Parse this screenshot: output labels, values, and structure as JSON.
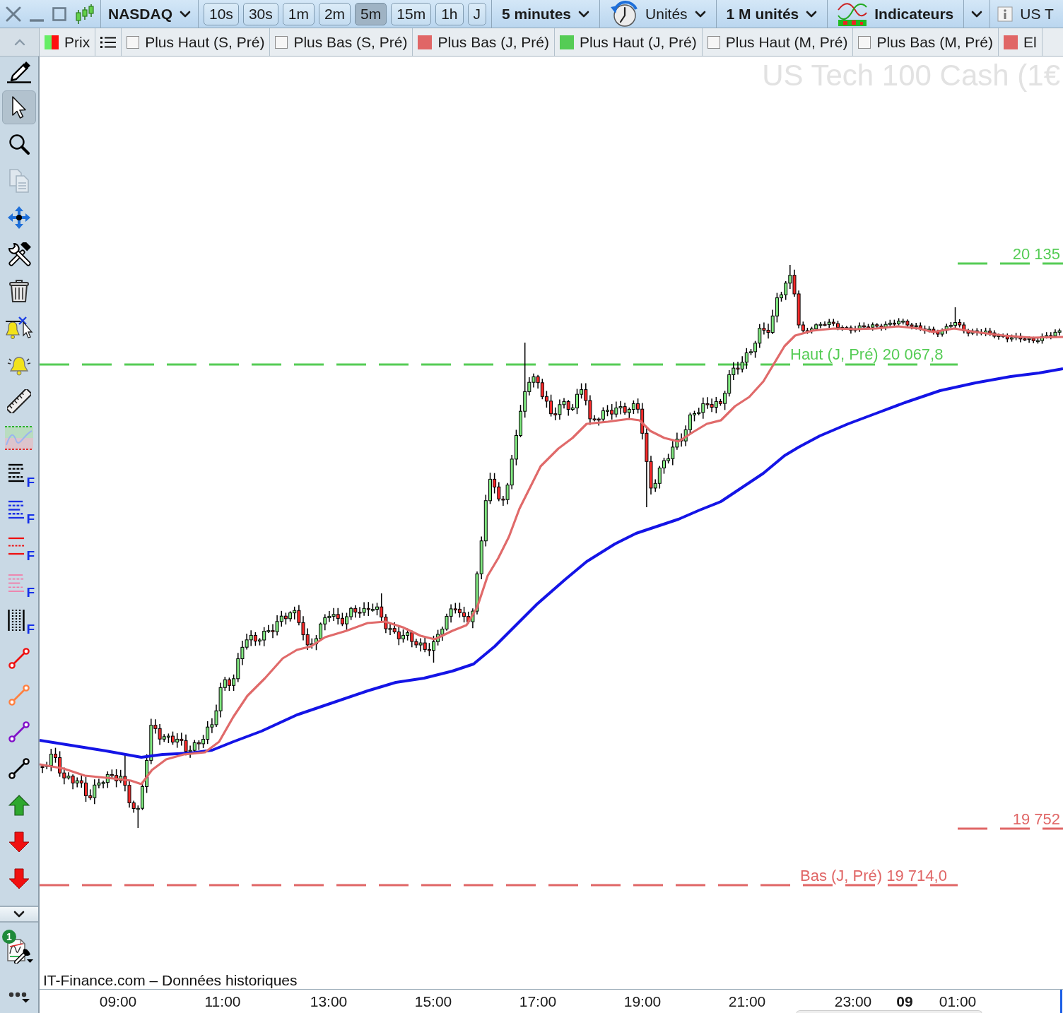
{
  "toolbar": {
    "market": "NASDAQ",
    "timeframes": [
      {
        "label": "10s",
        "selected": false
      },
      {
        "label": "30s",
        "selected": false
      },
      {
        "label": "1m",
        "selected": false
      },
      {
        "label": "2m",
        "selected": false
      },
      {
        "label": "5m",
        "selected": true
      },
      {
        "label": "15m",
        "selected": false
      },
      {
        "label": "1h",
        "selected": false
      },
      {
        "label": "J",
        "selected": false
      }
    ],
    "period": "5 minutes",
    "units": "Unités",
    "unit_count": "1 M unités",
    "indicators": "Indicateurs",
    "instrument": "US T"
  },
  "legend": {
    "items": [
      {
        "kind": "price",
        "label": "Prix"
      },
      {
        "kind": "list"
      },
      {
        "kind": "checkbox",
        "label": "Plus Haut (S, Pré)",
        "checked": false
      },
      {
        "kind": "checkbox",
        "label": "Plus Bas (S, Pré)",
        "checked": false
      },
      {
        "kind": "swatch",
        "label": "Plus Bas (J, Pré)",
        "color": "#e06666"
      },
      {
        "kind": "swatch",
        "label": "Plus Haut (J, Pré)",
        "color": "#55cc55"
      },
      {
        "kind": "checkbox",
        "label": "Plus Haut (M, Pré)",
        "checked": false
      },
      {
        "kind": "checkbox",
        "label": "Plus Bas (M, Pré)",
        "checked": false
      },
      {
        "kind": "swatch",
        "label": "El",
        "color": "#e06666"
      }
    ]
  },
  "tools": [
    {
      "kind": "pencil",
      "selected": false,
      "disabled": false
    },
    {
      "kind": "pointer",
      "selected": true,
      "disabled": false
    },
    {
      "kind": "zoom",
      "selected": false,
      "disabled": false
    },
    {
      "kind": "copy",
      "selected": false,
      "disabled": true
    },
    {
      "kind": "move",
      "selected": false,
      "disabled": false
    },
    {
      "kind": "tools",
      "selected": false,
      "disabled": false
    },
    {
      "kind": "trash",
      "selected": false,
      "disabled": false
    },
    {
      "kind": "alertcursor",
      "selected": false,
      "disabled": false
    },
    {
      "kind": "alert",
      "selected": false,
      "disabled": false
    },
    {
      "kind": "ruler",
      "selected": false,
      "disabled": false
    },
    {
      "kind": "band",
      "selected": false,
      "disabled": false
    },
    {
      "kind": "fibo",
      "label": "F",
      "selected": false,
      "disabled": false
    },
    {
      "kind": "fiboblue",
      "label": "F",
      "selected": false,
      "disabled": false
    },
    {
      "kind": "fibored",
      "label": "F",
      "selected": false,
      "disabled": false
    },
    {
      "kind": "fibopink",
      "label": "F",
      "selected": false,
      "disabled": false
    },
    {
      "kind": "fibotime",
      "label": "F",
      "selected": false,
      "disabled": false
    },
    {
      "kind": "segment",
      "color": "#ee1111",
      "selected": false,
      "disabled": false
    },
    {
      "kind": "segment",
      "color": "#ff8040",
      "selected": false,
      "disabled": false
    },
    {
      "kind": "segment",
      "color": "#8010c8",
      "selected": false,
      "disabled": false
    },
    {
      "kind": "segment",
      "color": "#000000",
      "selected": false,
      "disabled": false
    },
    {
      "kind": "uparrow",
      "selected": false,
      "disabled": false
    },
    {
      "kind": "downarrow",
      "selected": false,
      "disabled": false
    },
    {
      "kind": "downarrow",
      "selected": false,
      "disabled": false
    }
  ],
  "tool_panel": {
    "settings_badge": "1"
  },
  "chart": {
    "title": "US Tech 100 Cash (1€",
    "levels": [
      {
        "kind": "mark",
        "label": "20 135",
        "color": "#55cc55"
      },
      {
        "kind": "line",
        "label": "Haut (J, Pré) 20 067,8",
        "color": "#55cc55"
      },
      {
        "kind": "mark",
        "label": "19 752",
        "color": "#e06666"
      },
      {
        "kind": "line",
        "label": "Bas (J, Pré) 19 714,0",
        "color": "#e06666"
      }
    ],
    "source": "IT-Finance.com – Données historiques",
    "time_axis": [
      {
        "kind": "time",
        "label": "09:00"
      },
      {
        "kind": "time",
        "label": "11:00"
      },
      {
        "kind": "time",
        "label": "13:00"
      },
      {
        "kind": "time",
        "label": "15:00"
      },
      {
        "kind": "time",
        "label": "17:00"
      },
      {
        "kind": "time",
        "label": "19:00"
      },
      {
        "kind": "time",
        "label": "21:00"
      },
      {
        "kind": "time",
        "label": "23:00"
      },
      {
        "kind": "date",
        "label": "09"
      },
      {
        "kind": "time",
        "label": "01:00"
      }
    ]
  }
}
